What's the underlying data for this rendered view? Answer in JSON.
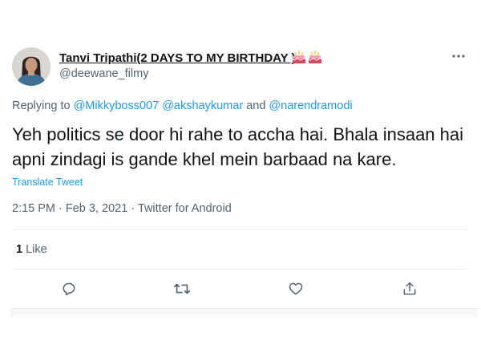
{
  "tweet": {
    "author_name": "Tanvi Tripathi(2 DAYS TO MY BIRTHDAY )",
    "author_handle": "@deewane_filmy",
    "name_emoji": [
      "birthday-cake",
      "birthday-cake"
    ],
    "replying_prefix": "Replying to ",
    "mentions": [
      "@Mikkyboss007",
      "@akshaykumar",
      "@narendramodi"
    ],
    "mention_joiner": "and",
    "text": "Yeh politics se door hi rahe to accha hai. Bhala insaan hai apni zindagi is gande khel mein barbaad na kare.",
    "translate_label": "Translate Tweet",
    "timestamp": "2:15 PM · Feb 3, 2021 · Twitter for Android",
    "like_count": "1",
    "like_label": "Like"
  },
  "actions": [
    "reply-icon",
    "retweet-icon",
    "like-icon",
    "share-icon"
  ],
  "colors": {
    "text_primary": "#0f1419",
    "text_secondary": "#536471",
    "link": "#1d9bf0",
    "divider": "#e6ecf0"
  }
}
